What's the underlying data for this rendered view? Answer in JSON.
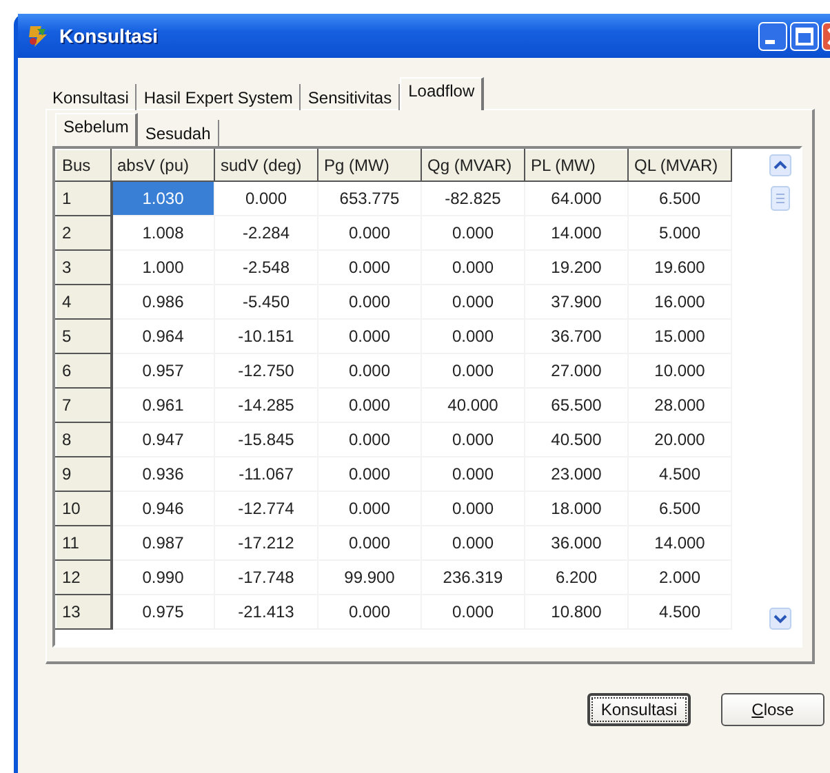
{
  "window": {
    "title": "Konsultasi"
  },
  "tabs": [
    {
      "label": "Konsultasi",
      "selected": false
    },
    {
      "label": "Hasil Expert System",
      "selected": false
    },
    {
      "label": "Sensitivitas",
      "selected": false
    },
    {
      "label": "Loadflow",
      "selected": true
    }
  ],
  "subtabs": [
    {
      "label": "Sebelum",
      "selected": true
    },
    {
      "label": "Sesudah",
      "selected": false
    }
  ],
  "table": {
    "columns": [
      "Bus",
      "absV (pu)",
      "sudV (deg)",
      "Pg (MW)",
      "Qg (MVAR)",
      "PL (MW)",
      "QL (MVAR)"
    ],
    "rows": [
      {
        "selected": true,
        "cells": [
          "1",
          "1.030",
          "0.000",
          "653.775",
          "-82.825",
          "64.000",
          "6.500"
        ]
      },
      {
        "selected": false,
        "cells": [
          "2",
          "1.008",
          "-2.284",
          "0.000",
          "0.000",
          "14.000",
          "5.000"
        ]
      },
      {
        "selected": false,
        "cells": [
          "3",
          "1.000",
          "-2.548",
          "0.000",
          "0.000",
          "19.200",
          "19.600"
        ]
      },
      {
        "selected": false,
        "cells": [
          "4",
          "0.986",
          "-5.450",
          "0.000",
          "0.000",
          "37.900",
          "16.000"
        ]
      },
      {
        "selected": false,
        "cells": [
          "5",
          "0.964",
          "-10.151",
          "0.000",
          "0.000",
          "36.700",
          "15.000"
        ]
      },
      {
        "selected": false,
        "cells": [
          "6",
          "0.957",
          "-12.750",
          "0.000",
          "0.000",
          "27.000",
          "10.000"
        ]
      },
      {
        "selected": false,
        "cells": [
          "7",
          "0.961",
          "-14.285",
          "0.000",
          "40.000",
          "65.500",
          "28.000"
        ]
      },
      {
        "selected": false,
        "cells": [
          "8",
          "0.947",
          "-15.845",
          "0.000",
          "0.000",
          "40.500",
          "20.000"
        ]
      },
      {
        "selected": false,
        "cells": [
          "9",
          "0.936",
          "-11.067",
          "0.000",
          "0.000",
          "23.000",
          "4.500"
        ]
      },
      {
        "selected": false,
        "cells": [
          "10",
          "0.946",
          "-12.774",
          "0.000",
          "0.000",
          "18.000",
          "6.500"
        ]
      },
      {
        "selected": false,
        "cells": [
          "11",
          "0.987",
          "-17.212",
          "0.000",
          "0.000",
          "36.000",
          "14.000"
        ]
      },
      {
        "selected": false,
        "cells": [
          "12",
          "0.990",
          "-17.748",
          "99.900",
          "236.319",
          "6.200",
          "2.000"
        ]
      },
      {
        "selected": false,
        "cells": [
          "13",
          "0.975",
          "-21.413",
          "0.000",
          "0.000",
          "10.800",
          "4.500"
        ]
      }
    ]
  },
  "buttons": [
    {
      "label": "Konsultasi",
      "default": true
    },
    {
      "label": "Close",
      "default": false
    }
  ]
}
